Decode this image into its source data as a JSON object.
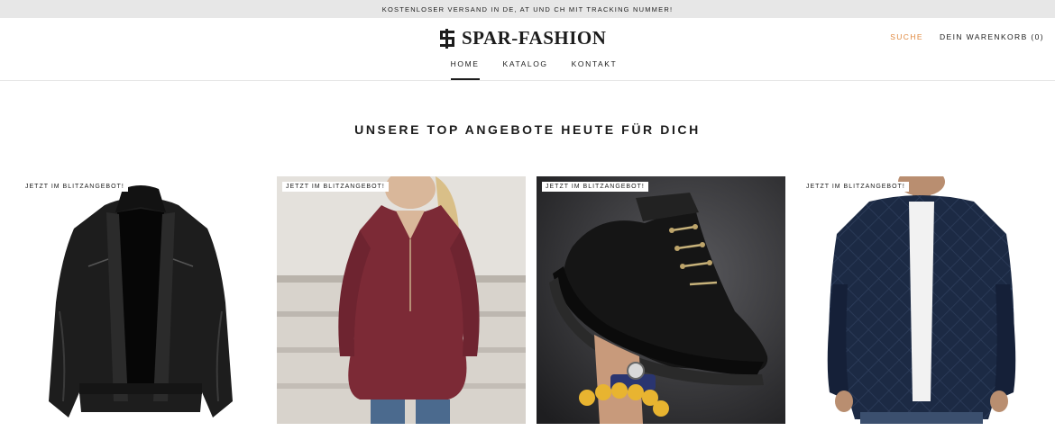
{
  "announcement": "KOSTENLOSER VERSAND IN DE, AT UND CH MIT TRACKING NUMMER!",
  "brand": {
    "name": "SPAR-FASHION"
  },
  "nav": [
    {
      "label": "HOME",
      "active": true
    },
    {
      "label": "KATALOG",
      "active": false
    },
    {
      "label": "KONTAKT",
      "active": false
    }
  ],
  "header": {
    "search_label": "SUCHE",
    "cart_label": "DEIN WARENKORB (0)"
  },
  "section": {
    "title": "UNSERE TOP ANGEBOTE HEUTE FÜR DICH"
  },
  "products": [
    {
      "badge": "JETZT IM BLITZANGEBOT!",
      "image": "black-leather-jacket"
    },
    {
      "badge": "JETZT IM BLITZANGEBOT!",
      "image": "burgundy-v-neck-tunic"
    },
    {
      "badge": "JETZT IM BLITZANGEBOT!",
      "image": "black-chunky-boot"
    },
    {
      "badge": "JETZT IM BLITZANGEBOT!",
      "image": "navy-quilted-bomber-jacket"
    }
  ],
  "colors": {
    "accent": "#e0893f",
    "text": "#1c1c1c",
    "announcement_bg": "#e7e7e7"
  }
}
